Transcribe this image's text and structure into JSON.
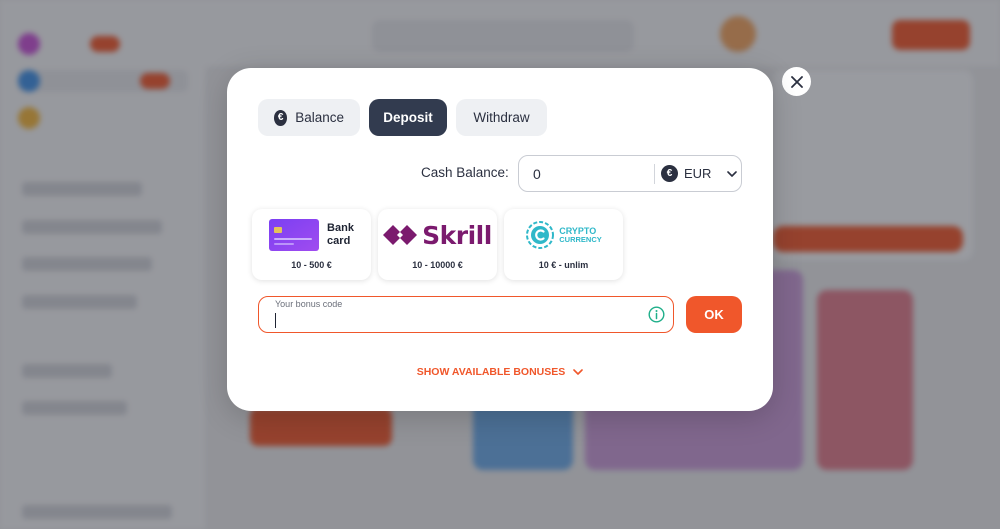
{
  "modal": {
    "tabs": [
      {
        "label": "Balance",
        "icon": "euro-icon",
        "active": false
      },
      {
        "label": "Deposit",
        "active": true
      },
      {
        "label": "Withdraw",
        "active": false
      }
    ],
    "cash_balance": {
      "label": "Cash Balance:",
      "value": "0",
      "currency": "EUR",
      "currency_icon": "euro-icon"
    },
    "payment_methods": [
      {
        "name": "Bank card",
        "line1": "Bank",
        "line2": "card",
        "range": "10 - 500 €",
        "icon": "bank-card-icon"
      },
      {
        "name": "Skrill",
        "logo_text": "Skrill",
        "range": "10 - 10000 €",
        "icon": "skrill-logo"
      },
      {
        "name": "Crypto currency",
        "line1": "CRYPTO",
        "line2": "CURRENCY",
        "range": "10 € - unlim",
        "icon": "crypto-logo"
      }
    ],
    "bonus_code": {
      "label": "Your bonus code",
      "value": ""
    },
    "ok_label": "OK",
    "show_bonuses_label": "SHOW AVAILABLE BONUSES"
  },
  "colors": {
    "accent": "#f0572b",
    "dark_tab": "#323b4f",
    "skrill": "#7b1a6e",
    "crypto": "#2fb8c9",
    "card": "#8a3cf0"
  }
}
